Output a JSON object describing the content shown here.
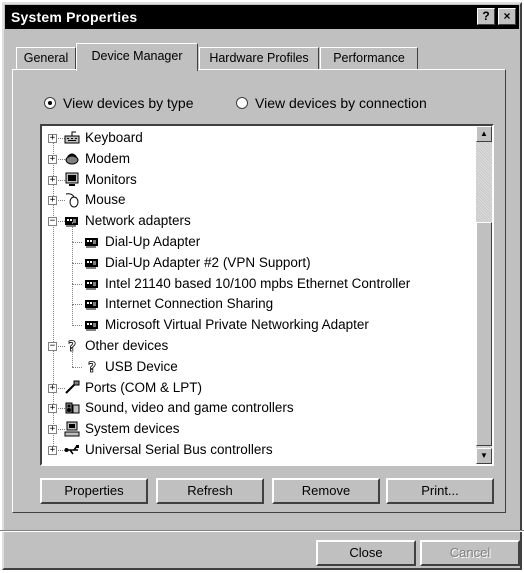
{
  "window": {
    "title": "System Properties"
  },
  "titlebar": {
    "help_label": "?",
    "close_label": "×"
  },
  "tabs": [
    {
      "label": "General"
    },
    {
      "label": "Device Manager"
    },
    {
      "label": "Hardware Profiles"
    },
    {
      "label": "Performance"
    }
  ],
  "view_options": {
    "by_type": "View devices by type",
    "by_connection": "View devices by connection",
    "selected": "by_type"
  },
  "tree": [
    {
      "label": "Keyboard",
      "icon": "keyboard-icon",
      "expanded": false
    },
    {
      "label": "Modem",
      "icon": "modem-icon",
      "expanded": false
    },
    {
      "label": "Monitors",
      "icon": "monitor-icon",
      "expanded": false
    },
    {
      "label": "Mouse",
      "icon": "mouse-icon",
      "expanded": false
    },
    {
      "label": "Network adapters",
      "icon": "network-adapter-icon",
      "expanded": true
    },
    {
      "label": "Dial-Up Adapter",
      "icon": "network-adapter-icon",
      "child": true
    },
    {
      "label": "Dial-Up Adapter #2 (VPN Support)",
      "icon": "network-adapter-icon",
      "child": true
    },
    {
      "label": "Intel 21140 based 10/100 mpbs Ethernet Controller",
      "icon": "network-adapter-icon",
      "child": true
    },
    {
      "label": "Internet Connection Sharing",
      "icon": "network-adapter-icon",
      "child": true
    },
    {
      "label": "Microsoft Virtual Private Networking Adapter",
      "icon": "network-adapter-icon",
      "child": true
    },
    {
      "label": "Other devices",
      "icon": "question-icon",
      "expanded": true
    },
    {
      "label": "USB Device",
      "icon": "question-icon",
      "child": true
    },
    {
      "label": "Ports (COM & LPT)",
      "icon": "port-icon",
      "expanded": false
    },
    {
      "label": "Sound, video and game controllers",
      "icon": "sound-icon",
      "expanded": false
    },
    {
      "label": "System devices",
      "icon": "computer-icon",
      "expanded": false
    },
    {
      "label": "Universal Serial Bus controllers",
      "icon": "usb-icon",
      "expanded": false
    }
  ],
  "buttons": {
    "properties": "Properties",
    "refresh": "Refresh",
    "remove": "Remove",
    "print": "Print...",
    "close": "Close",
    "cancel": "Cancel"
  }
}
